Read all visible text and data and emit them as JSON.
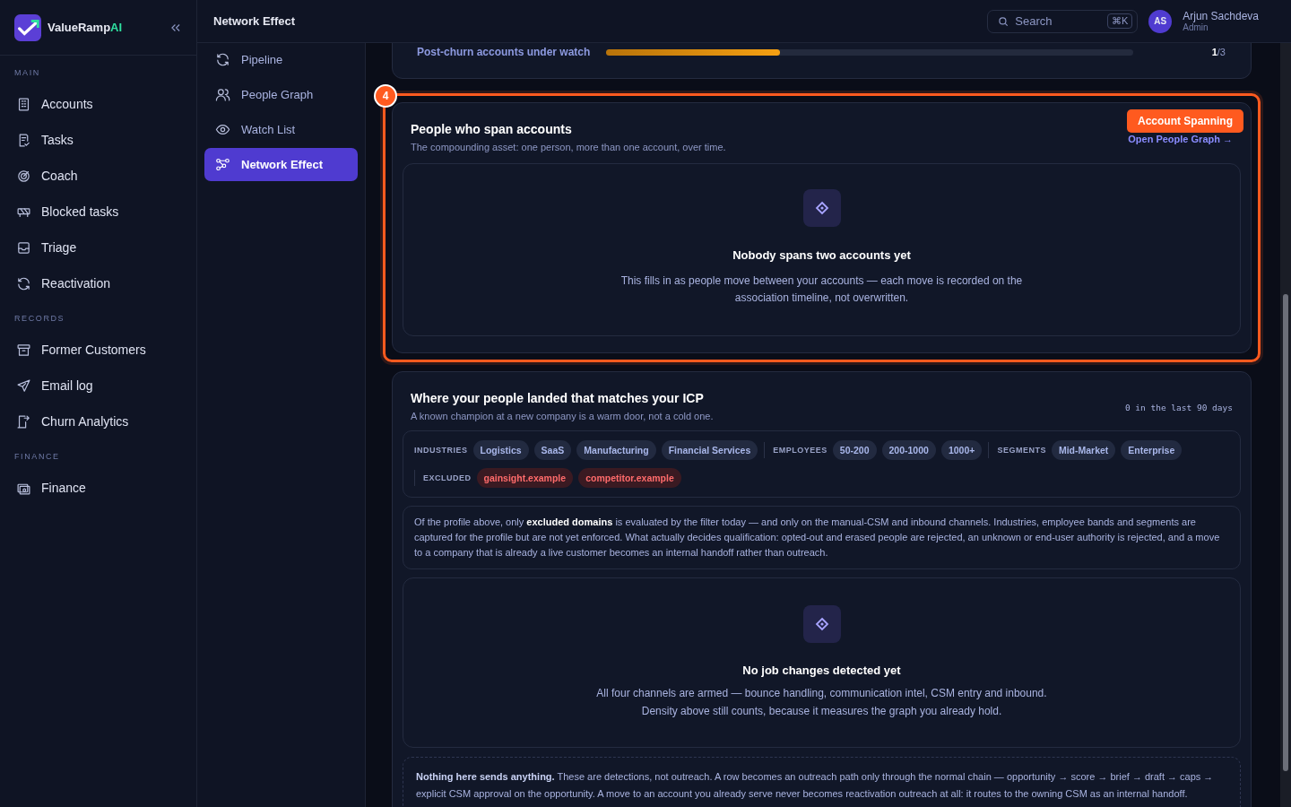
{
  "brand": {
    "name": "ValueRamp",
    "accent": "AI"
  },
  "sidebar": {
    "sections": [
      {
        "title": "MAIN",
        "items": [
          {
            "label": "Accounts",
            "selected": false
          },
          {
            "label": "Tasks",
            "selected": false
          },
          {
            "label": "Coach",
            "selected": false
          },
          {
            "label": "Blocked tasks",
            "selected": false
          },
          {
            "label": "Triage",
            "selected": false
          },
          {
            "label": "Reactivation",
            "selected": false
          }
        ]
      },
      {
        "title": "RECORDS",
        "items": [
          {
            "label": "Former Customers",
            "selected": false
          },
          {
            "label": "Email log",
            "selected": false
          },
          {
            "label": "Churn Analytics",
            "selected": false
          }
        ]
      },
      {
        "title": "FINANCE",
        "items": [
          {
            "label": "Finance",
            "selected": false
          }
        ]
      }
    ]
  },
  "subnav": {
    "title": "Network Effect",
    "items": [
      {
        "label": "Pipeline",
        "selected": false
      },
      {
        "label": "People Graph",
        "selected": false
      },
      {
        "label": "Watch List",
        "selected": false
      },
      {
        "label": "Network Effect",
        "selected": true
      }
    ]
  },
  "search": {
    "placeholder": "Search",
    "shortcut": "⌘K"
  },
  "user": {
    "initials": "AS",
    "name": "Arjun Sachdeva",
    "role": "Admin"
  },
  "watch": {
    "label": "Post-churn accounts under watch",
    "level": 0.33,
    "reading": "**1**/3"
  },
  "spanning": {
    "step": "4",
    "tag": "Account Spanning",
    "title": "People who span accounts",
    "subtitle": "The compounding asset: one person, more than one account, over time.",
    "link": "Open People Graph →",
    "empty_title": "Nobody spans two accounts yet",
    "empty_text": "This fills in as people move between your accounts — each move is recorded on the association timeline, not overwritten."
  },
  "icp": {
    "title": "Where your people landed that matches your ICP",
    "subtitle": "A known champion at a new company is a warm door, not a cold one.",
    "count_note": "0 in the last 90 days",
    "filters": [
      {
        "label": "INDUSTRIES",
        "kind": "include",
        "tags": [
          "Logistics",
          "SaaS",
          "Manufacturing",
          "Financial Services"
        ]
      },
      {
        "label": "EMPLOYEES",
        "kind": "include",
        "tags": [
          "50-200",
          "200-1000",
          "1000+"
        ]
      },
      {
        "label": "SEGMENTS",
        "kind": "include",
        "tags": [
          "Mid-Market",
          "Enterprise"
        ]
      },
      {
        "label": "EXCLUDED",
        "kind": "exclude",
        "tags": [
          "gainsight.example",
          "competitor.example"
        ]
      }
    ],
    "note": "Of the profile above, only **excluded domains** is evaluated by the filter today — and only on the manual-CSM and inbound channels. Industries, employee bands and segments are captured for the profile but are not yet enforced. What actually decides qualification: opted-out and erased people are rejected, an unknown or end-user authority is rejected, and a move to a company that is already a live customer becomes an internal handoff rather than outreach.",
    "empty_title": "No job changes detected yet",
    "empty_lines": [
      "All four channels are armed — bounce handling, communication intel, CSM entry and inbound.",
      "Density above still counts, because it measures the graph you already hold."
    ],
    "footer": "**Nothing here sends anything.** These are detections, not outreach. A row becomes an outreach path only through the normal chain — opportunity → score → brief → draft → caps → explicit CSM approval on the opportunity. A move to an account you already serve never becomes reactivation outreach at all: it routes to the owning CSM as an internal handoff."
  }
}
